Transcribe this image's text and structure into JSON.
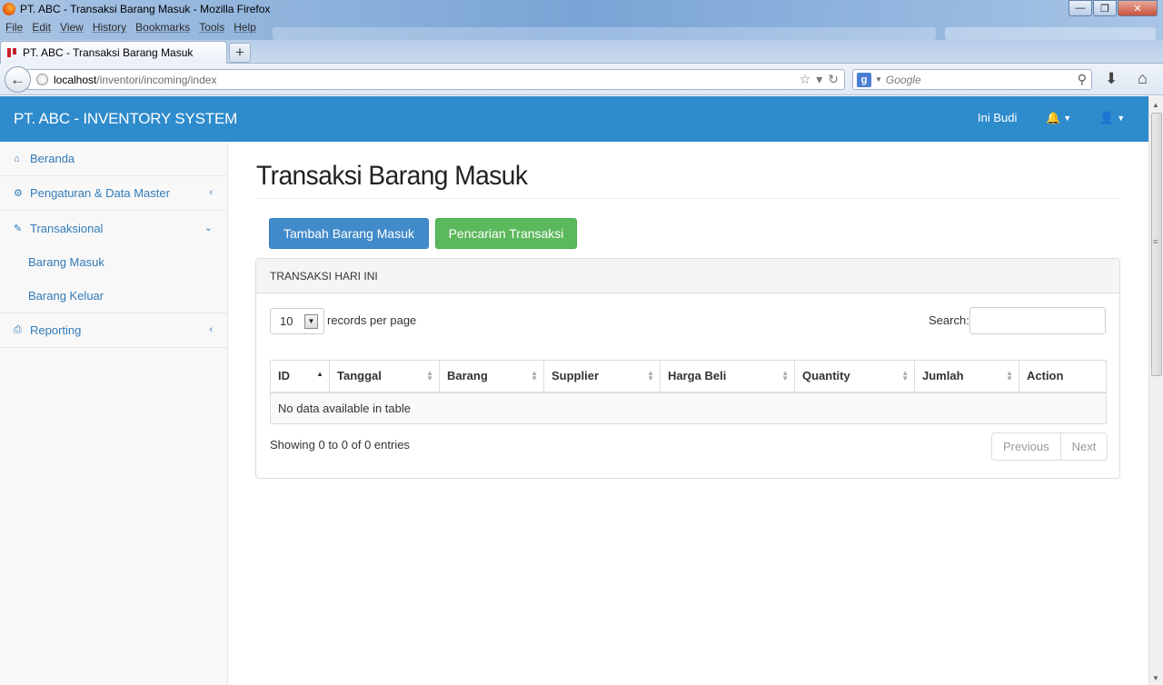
{
  "browser": {
    "window_title": "PT. ABC - Transaksi Barang Masuk - Mozilla Firefox",
    "menu": [
      "File",
      "Edit",
      "View",
      "History",
      "Bookmarks",
      "Tools",
      "Help"
    ],
    "tab_title": "PT. ABC - Transaksi Barang Masuk",
    "url_host": "localhost",
    "url_path": "/inventori/incoming/index",
    "search_placeholder": "Google",
    "search_engine_letter": "g"
  },
  "header": {
    "brand": "PT. ABC - INVENTORY SYSTEM",
    "user": "Ini Budi"
  },
  "sidebar": {
    "items": [
      {
        "label": "Beranda",
        "icon": "home-icon"
      },
      {
        "label": "Pengaturan & Data Master",
        "icon": "gears-icon"
      },
      {
        "label": "Transaksional",
        "icon": "edit-icon",
        "children": [
          "Barang Masuk",
          "Barang Keluar"
        ]
      },
      {
        "label": "Reporting",
        "icon": "print-icon"
      }
    ]
  },
  "main": {
    "title": "Transaksi Barang Masuk",
    "btn_add": "Tambah Barang Masuk",
    "btn_search": "Pencarian Transaksi",
    "panel_title": "TRANSAKSI HARI INI",
    "length_value": "10",
    "length_label": "records per page",
    "search_label": "Search:",
    "columns": [
      "ID",
      "Tanggal",
      "Barang",
      "Supplier",
      "Harga Beli",
      "Quantity",
      "Jumlah",
      "Action"
    ],
    "empty_text": "No data available in table",
    "info": "Showing 0 to 0 of 0 entries",
    "prev": "Previous",
    "next": "Next"
  },
  "colors": {
    "header_bg": "#2e8bcc",
    "primary": "#428bca",
    "success": "#5cb85c",
    "link": "#337ab7"
  }
}
